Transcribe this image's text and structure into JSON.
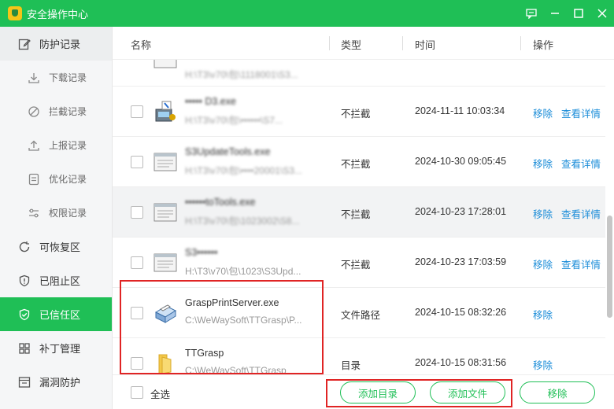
{
  "window": {
    "title": "安全操作中心",
    "controls": [
      "feedback-icon",
      "minimize-icon",
      "maximize-icon",
      "close-icon"
    ]
  },
  "sidebar": {
    "items": [
      {
        "label": "防护记录",
        "icon": "edit-icon"
      },
      {
        "label": "下载记录",
        "icon": "download-icon"
      },
      {
        "label": "拦截记录",
        "icon": "block-icon"
      },
      {
        "label": "上报记录",
        "icon": "upload-icon"
      },
      {
        "label": "优化记录",
        "icon": "list-icon"
      },
      {
        "label": "权限记录",
        "icon": "sliders-icon"
      },
      {
        "label": "可恢复区",
        "icon": "restore-icon"
      },
      {
        "label": "已阻止区",
        "icon": "shield-alert-icon"
      },
      {
        "label": "已信任区",
        "icon": "shield-check-icon"
      },
      {
        "label": "补丁管理",
        "icon": "grid-icon"
      },
      {
        "label": "漏洞防护",
        "icon": "window-icon"
      }
    ],
    "active": "已信任区"
  },
  "table": {
    "columns": {
      "name": "名称",
      "type": "类型",
      "time": "时间",
      "action": "操作"
    },
    "rows": [
      {
        "name": "",
        "path": "H:\\T3\\v70\\包\\1118001\\S3...",
        "type": "",
        "time": "",
        "remove": "",
        "detail": ""
      },
      {
        "name": "••••• D3.exe",
        "path": "H:\\T3\\v70\\包\\••••••\\S7...",
        "type": "不拦截",
        "time": "2024-11-11 10:03:34",
        "remove": "移除",
        "detail": "查看详情"
      },
      {
        "name": "S3UpdateTools.exe",
        "path": "H:\\T3\\v70\\包\\••••20001\\S3...",
        "type": "不拦截",
        "time": "2024-10-30 09:05:45",
        "remove": "移除",
        "detail": "查看详情"
      },
      {
        "name": "••••••toTools.exe",
        "path": "H:\\T3\\v70\\包\\1023002\\S8...",
        "type": "不拦截",
        "time": "2024-10-23 17:28:01",
        "remove": "移除",
        "detail": "查看详情"
      },
      {
        "name": "S3••••••",
        "path": "H:\\T3\\v70\\包\\1023\\S3Upd...",
        "type": "不拦截",
        "time": "2024-10-23 17:03:59",
        "remove": "移除",
        "detail": "查看详情"
      },
      {
        "name": "GraspPrintServer.exe",
        "path": "C:\\WeWaySoft\\TTGrasp\\P...",
        "type": "文件路径",
        "time": "2024-10-15 08:32:26",
        "remove": "移除",
        "detail": ""
      },
      {
        "name": "TTGrasp",
        "path": "C:\\WeWaySoft\\TTGrasp",
        "type": "目录",
        "time": "2024-10-15 08:31:56",
        "remove": "移除",
        "detail": ""
      }
    ]
  },
  "footer": {
    "select_all": "全选",
    "add_dir": "添加目录",
    "add_file": "添加文件",
    "remove": "移除"
  },
  "colors": {
    "accent": "#1fbf56",
    "link": "#1a8cd8",
    "highlight_box": "#e02424"
  }
}
